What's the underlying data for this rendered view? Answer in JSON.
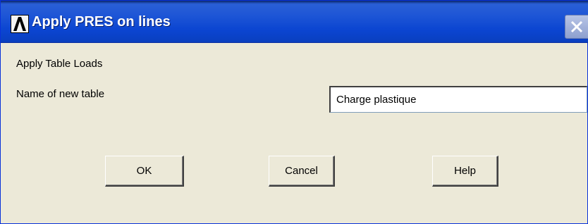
{
  "window": {
    "title": "Apply PRES on lines",
    "app_icon": "ansys-lambda-icon",
    "close_icon": "close-icon"
  },
  "content": {
    "heading": "Apply Table Loads",
    "name_label": "Name of new table",
    "name_value": "Charge plastique"
  },
  "buttons": {
    "ok": "OK",
    "cancel": "Cancel",
    "help": "Help"
  },
  "colors": {
    "titlebar": "#0b45d1",
    "dialog_bg": "#ece9d8"
  }
}
